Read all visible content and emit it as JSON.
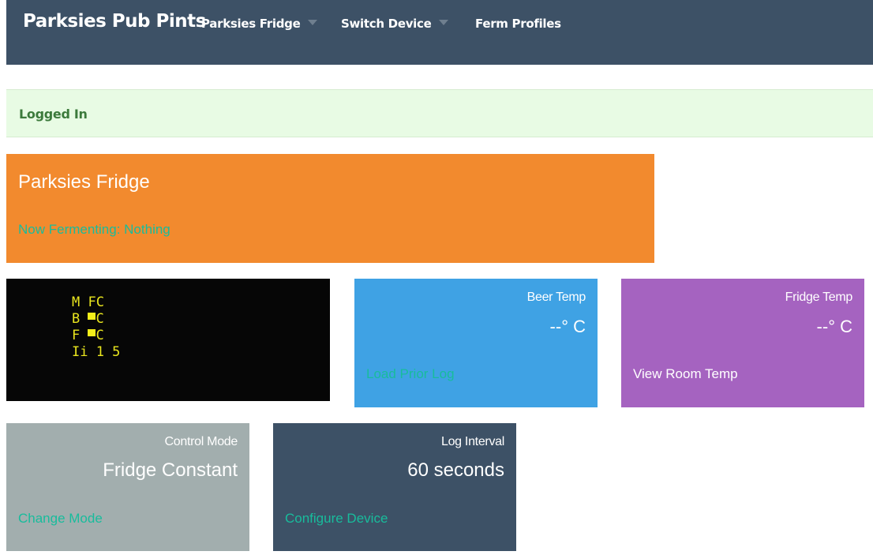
{
  "navbar": {
    "brand": "Parksies Pub Pints",
    "items": [
      {
        "label": "Parksies Fridge",
        "dropdown": true
      },
      {
        "label": "Switch Device",
        "dropdown": true
      },
      {
        "label": "Ferm Profiles",
        "dropdown": false
      }
    ]
  },
  "alert": {
    "text": "Logged In"
  },
  "device": {
    "name": "Parksies Fridge",
    "fermenting_text": "Now Fermenting: Nothing"
  },
  "lcd": {
    "lines": [
      "M FC",
      "B ",
      "F ",
      "Ii 1 5"
    ],
    "line_suffix": "C"
  },
  "beer_temp": {
    "label": "Beer Temp",
    "value": "--° C",
    "link": "Load Prior Log"
  },
  "fridge_temp": {
    "label": "Fridge Temp",
    "value": "--° C",
    "link": "View Room Temp"
  },
  "control_mode": {
    "label": "Control Mode",
    "value": "Fridge Constant",
    "link": "Change Mode"
  },
  "log_interval": {
    "label": "Log Interval",
    "value": "60 seconds",
    "link": "Configure Device"
  },
  "colors": {
    "navbar": "#3d5166",
    "alert_bg": "#e8fbe4",
    "device_tile": "#f28a2e",
    "beer_tile": "#3fa2e4",
    "fridge_tile": "#a563c0",
    "control_tile": "#a2aeae",
    "interval_tile": "#3d5166",
    "link_green": "#18bc9c",
    "lcd_text": "#e9e51e"
  }
}
